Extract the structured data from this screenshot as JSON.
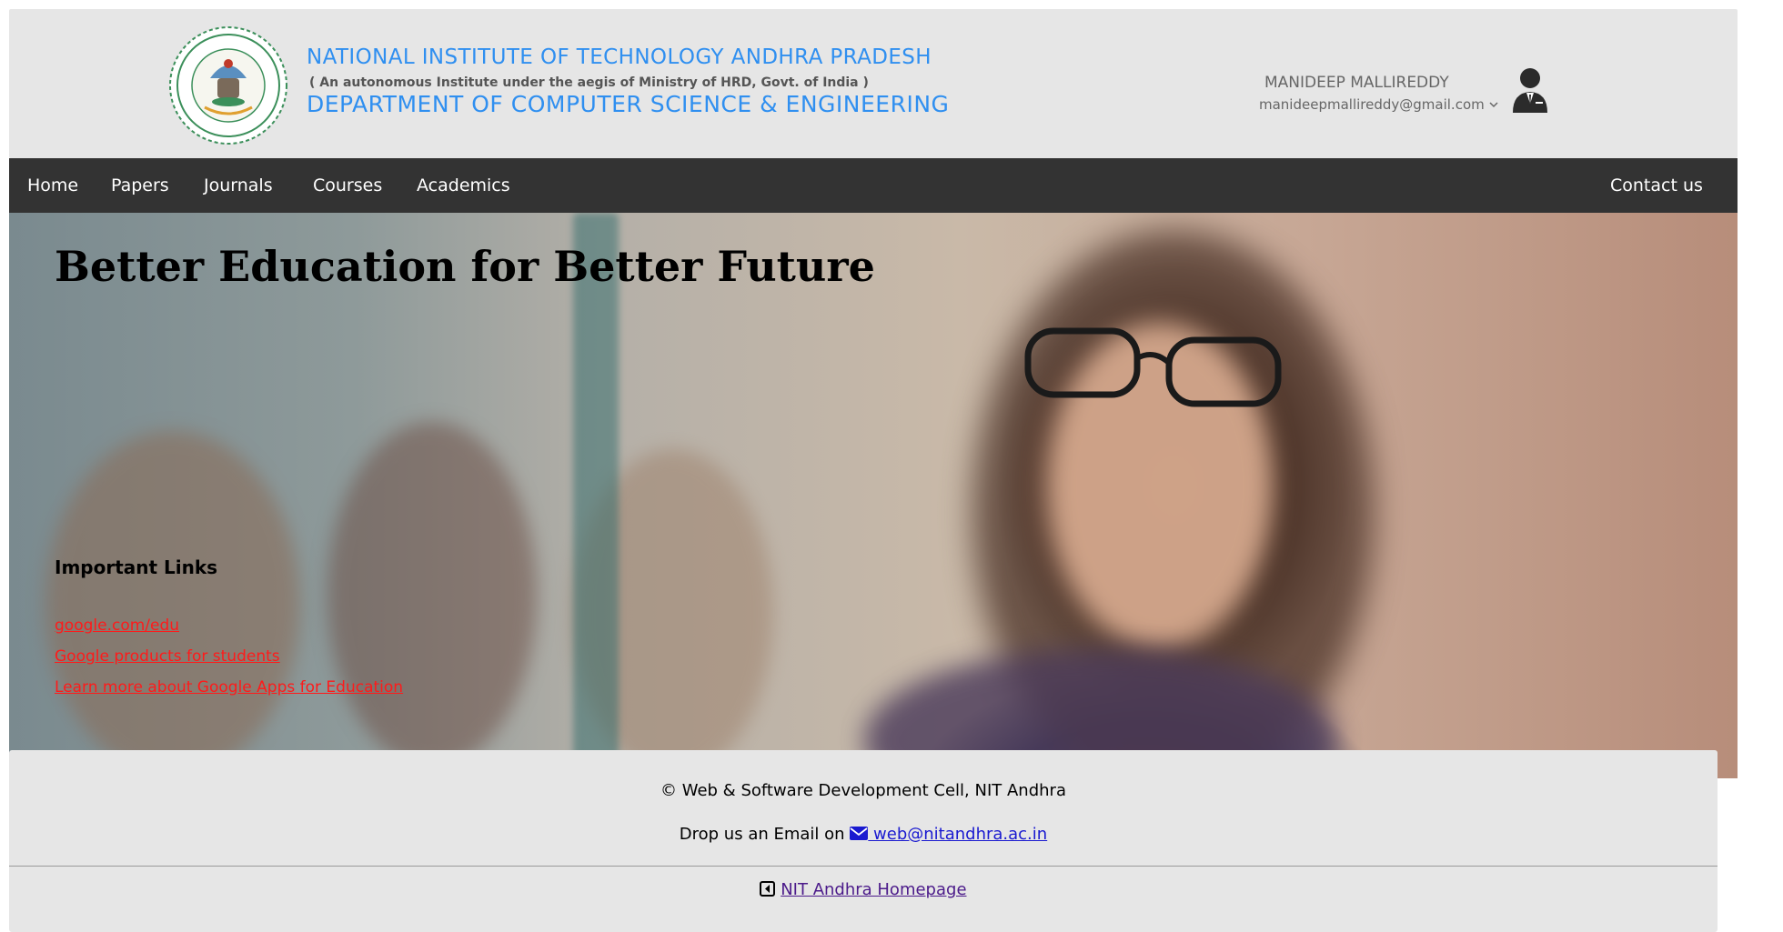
{
  "header": {
    "institute_name": "NATIONAL INSTITUTE OF TECHNOLOGY ANDHRA PRADESH",
    "institute_subtitle": "( An autonomous Institute under the aegis of Ministry of HRD, Govt. of India )",
    "department_name": "DEPARTMENT OF COMPUTER SCIENCE & ENGINEERING",
    "logo_icon": "nit-andhra-seal-icon",
    "user": {
      "name": "MANIDEEP MALLIREDDY",
      "email": "manideepmallireddy@gmail.com",
      "dropdown_icon": "chevron-down-icon",
      "avatar_icon": "user-business-icon"
    }
  },
  "nav": {
    "items": [
      {
        "label": "Home"
      },
      {
        "label": "Papers"
      },
      {
        "label": "Journals"
      },
      {
        "label": "Courses"
      },
      {
        "label": "Academics"
      }
    ],
    "contact_label": "Contact us"
  },
  "hero": {
    "heading": "Better Education for Better Future",
    "links_heading": "Important Links",
    "links": [
      {
        "label": "google.com/edu"
      },
      {
        "label": "Google products for students"
      },
      {
        "label": "Learn more about Google Apps for Education"
      }
    ]
  },
  "footer": {
    "copyright": "© Web & Software Development Cell, NIT Andhra",
    "email_prefix": "Drop us an Email on",
    "email": " web@nitandhra.ac.in",
    "homepage_label": "NIT Andhra Homepage"
  },
  "colors": {
    "header_bg": "#e6e6e6",
    "title_blue": "#2f8ff0",
    "nav_bg": "#333333",
    "link_red": "#ff1a1a"
  }
}
